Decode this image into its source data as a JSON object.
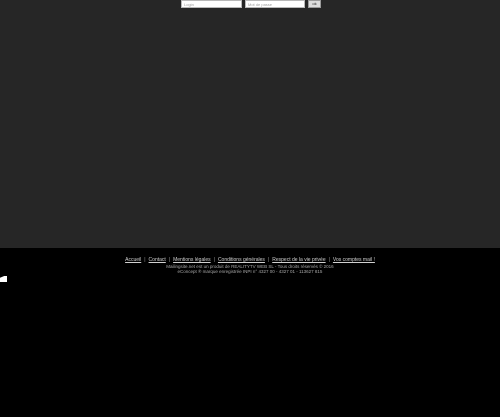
{
  "header": {
    "login_placeholder": "Login",
    "password_placeholder": "Mot de passe",
    "submit_label": "ok"
  },
  "footer": {
    "links": [
      {
        "label": "Accueil"
      },
      {
        "label": "Contact"
      },
      {
        "label": "Mentions légales"
      },
      {
        "label": "Conditions générales"
      },
      {
        "label": "Respect de la vie privée"
      },
      {
        "label": "Vos comptes mail !"
      }
    ],
    "line1": "Mailingsite.net est un produit de REALITYTV WEB SL - Tous droits réservés © 2016",
    "line2": "eConcept ® marque enregistrée INPI n° 4327 00 - 4327 01 - 113627 815"
  }
}
